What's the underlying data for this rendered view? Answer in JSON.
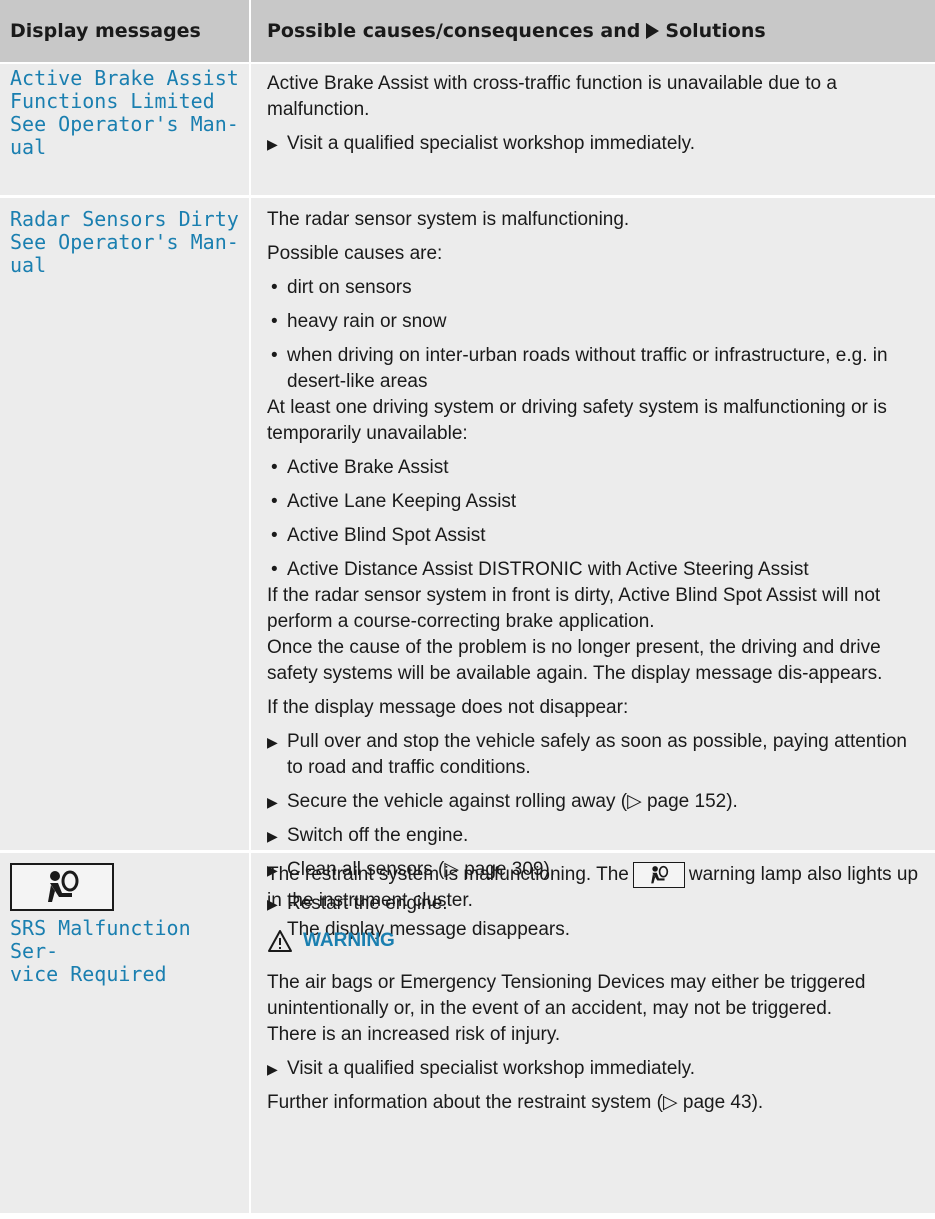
{
  "header": {
    "col1": "Display messages",
    "col2_prefix": "Possible causes/consequences and",
    "col2_suffix": "Solutions"
  },
  "rows": [
    {
      "message": "Active Brake Assist\nFunctions Limited\nSee Operator's Man-\nual",
      "text1": "Active Brake Assist with cross-traffic function is unavailable due to a malfunction.",
      "step1": "Visit a qualified specialist workshop immediately."
    },
    {
      "message": "Radar Sensors Dirty\nSee Operator's Man-\nual",
      "p1": "The radar sensor system is malfunctioning.",
      "p2": "Possible causes are:",
      "causes": [
        "dirt on sensors",
        "heavy rain or snow",
        "when driving on inter-urban roads without traffic or infrastructure, e.g. in desert-like areas"
      ],
      "p3": "At least one driving system or driving safety system is malfunctioning or is temporarily unavailable:",
      "systems": [
        "Active Brake Assist",
        "Active Lane Keeping Assist",
        "Active Blind Spot Assist",
        "Active Distance Assist DISTRONIC with Active Steering Assist"
      ],
      "p4": "If the radar sensor system in front is dirty, Active Blind Spot Assist will not perform a course-correcting brake application.",
      "p5": "Once the cause of the problem is no longer present, the driving and drive safety systems will be available again. The display message dis-appears.",
      "p6": "If the display message does not disappear:",
      "steps": [
        "Pull over and stop the vehicle safely as soon as possible, paying attention to road and traffic conditions.",
        "Secure the vehicle against rolling away (▷ page 152).",
        "Switch off the engine.",
        "Clean all sensors (▷ page 309).",
        "Restart the engine."
      ],
      "result": "The display message disappears."
    },
    {
      "message": "SRS Malfunction Ser-\nvice Required",
      "icon": "airbag-warning-icon",
      "p1_before": "The restraint system is malfunctioning. The",
      "p1_after": "warning lamp also lights up in the instrument cluster.",
      "warning_title": "WARNING",
      "warning_text": "The air bags or Emergency Tensioning Devices may either be triggered unintentionally or, in the event of an accident, may not be triggered.",
      "warning_text2": "There is an increased risk of injury.",
      "step1": "Visit a qualified specialist workshop immediately.",
      "p_last": "Further information about the restraint system (▷ page 43)."
    }
  ],
  "colors": {
    "header_bg": "#c8c8c8",
    "row_bg": "#ececec",
    "accent": "#1a7fb0"
  }
}
